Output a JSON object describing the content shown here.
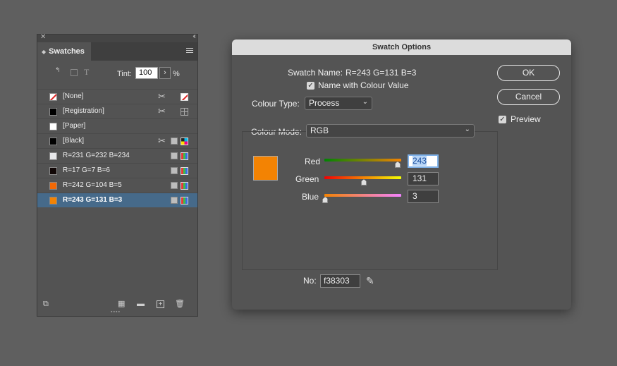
{
  "swatches_panel": {
    "tab_title": "Swatches",
    "tint_label": "Tint:",
    "tint_value": "100",
    "tint_unit": "%",
    "swatches": [
      {
        "name": "[None]",
        "color": "#ffffff",
        "selected": false
      },
      {
        "name": "[Registration]",
        "color": "#000000",
        "selected": false
      },
      {
        "name": "[Paper]",
        "color": "#ffffff",
        "selected": false
      },
      {
        "name": "[Black]",
        "color": "#000000",
        "selected": false
      },
      {
        "name": "R=231 G=232 B=234",
        "color": "#e7e8ea",
        "selected": false
      },
      {
        "name": "R=17 G=7 B=6",
        "color": "#110706",
        "selected": false
      },
      {
        "name": "R=242 G=104 B=5",
        "color": "#f26805",
        "selected": false
      },
      {
        "name": "R=243 G=131 B=3",
        "color": "#f38303",
        "selected": true
      }
    ]
  },
  "dialog": {
    "title": "Swatch Options",
    "swatch_name_label": "Swatch Name:",
    "swatch_name_value": "R=243 G=131 B=3",
    "name_with_value_label": "Name with Colour Value",
    "name_with_value_checked": true,
    "colour_type_label": "Colour Type:",
    "colour_type_value": "Process",
    "colour_mode_label": "Colour Mode:",
    "colour_mode_value": "RGB",
    "ok_label": "OK",
    "cancel_label": "Cancel",
    "preview_label": "Preview",
    "preview_checked": true,
    "swatch_color": "#f38303",
    "channels": [
      {
        "label": "Red",
        "value": "243",
        "fraction": 0.953
      },
      {
        "label": "Green",
        "value": "131",
        "fraction": 0.514
      },
      {
        "label": "Blue",
        "value": "3",
        "fraction": 0.012
      }
    ],
    "hex_label": "No:",
    "hex_value": "f38303"
  }
}
